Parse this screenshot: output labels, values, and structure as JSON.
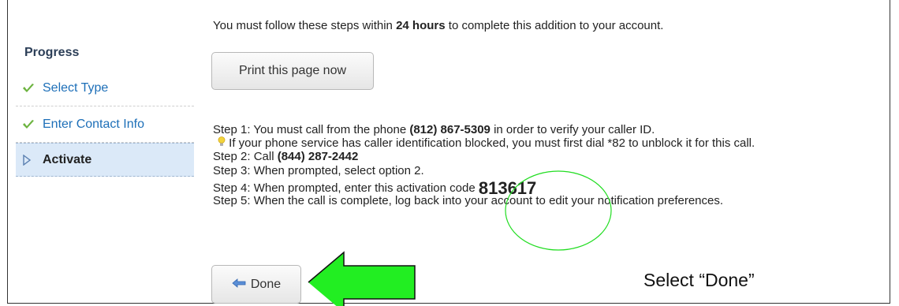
{
  "progress": {
    "title": "Progress",
    "steps": [
      {
        "label": "Select Type",
        "status": "complete",
        "icon": "check-icon"
      },
      {
        "label": "Enter Contact Info",
        "status": "complete",
        "icon": "check-icon"
      },
      {
        "label": "Activate",
        "status": "current",
        "icon": "triangle-right-icon"
      }
    ]
  },
  "main": {
    "intro": {
      "before": "You must follow these steps within ",
      "bold": "24 hours",
      "after": " to complete this addition to your account."
    },
    "print_button": "Print this page now",
    "step1": {
      "before": "Step 1: You must call from the phone ",
      "phone": "(812) 867-5309",
      "after": " in order to verify your caller ID."
    },
    "hint": "If your phone service has caller identification blocked, you must first dial *82 to unblock it for this call.",
    "step2": {
      "before": "Step 2: Call ",
      "phone": "(844) 287-2442"
    },
    "step3": "Step 3: When prompted, select option 2.",
    "step4": {
      "before": "Step 4: When prompted, enter this activation code ",
      "code": "813617"
    },
    "step5": "Step 5: When the call is complete, log back into your account to edit your notification preferences.",
    "done_button": "Done",
    "callout": "Select “Done”"
  },
  "colors": {
    "check": "#6cb33f",
    "link": "#1d6fb8",
    "annotation": "#22dd22",
    "active_bg": "#dbe9f8"
  }
}
